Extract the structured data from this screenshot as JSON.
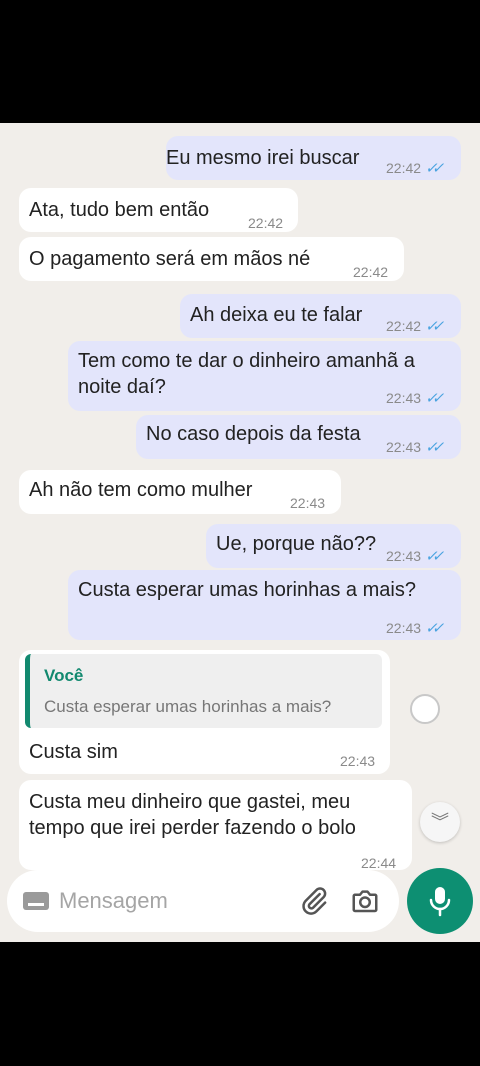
{
  "messages": [
    {
      "id": "m1",
      "direction": "out",
      "text": "Eu mesmo irei buscar",
      "time": "22:42",
      "status": "read"
    },
    {
      "id": "m2",
      "direction": "in",
      "text": "Ata, tudo bem então",
      "time": "22:42"
    },
    {
      "id": "m3",
      "direction": "in",
      "text": "O pagamento será em mãos né",
      "time": "22:42"
    },
    {
      "id": "m4",
      "direction": "out",
      "text": "Ah deixa eu te falar",
      "time": "22:42",
      "status": "read"
    },
    {
      "id": "m5",
      "direction": "out",
      "text": "Tem como te dar o dinheiro amanhã a\nnoite daí?",
      "time": "22:43",
      "status": "read"
    },
    {
      "id": "m6",
      "direction": "out",
      "text": "No caso depois da festa",
      "time": "22:43",
      "status": "read"
    },
    {
      "id": "m7",
      "direction": "in",
      "text": "Ah não tem como mulher",
      "time": "22:43"
    },
    {
      "id": "m8",
      "direction": "out",
      "text": "Ue, porque não??",
      "time": "22:43",
      "status": "read"
    },
    {
      "id": "m9",
      "direction": "out",
      "text": "Custa esperar umas horinhas a mais?",
      "time": "22:43",
      "status": "read"
    },
    {
      "id": "m10",
      "direction": "in",
      "text": "Custa sim",
      "time": "22:43",
      "quote": {
        "author": "Você",
        "text": "Custa esperar umas horinhas a mais?"
      }
    },
    {
      "id": "m11",
      "direction": "in",
      "text": "Custa meu dinheiro que gastei, meu\ntempo que irei perder fazendo o bolo",
      "time": "22:44"
    }
  ],
  "tick_glyph": "✓✓",
  "input": {
    "placeholder": "Mensagem"
  },
  "icons": {
    "keyboard": "keyboard-icon",
    "attach": "paperclip-icon",
    "camera": "camera-icon",
    "mic": "microphone-icon",
    "scroll_down": "double-chevron-down-icon"
  },
  "scroll_down_glyph": "︾",
  "colors": {
    "chat_background": "#f1eeea",
    "outgoing_bubble": "#e3e5fb",
    "incoming_bubble": "#ffffff",
    "read_ticks": "#4aa3e0",
    "quote_accent": "#12896f",
    "mic_button": "#0d8f72"
  }
}
